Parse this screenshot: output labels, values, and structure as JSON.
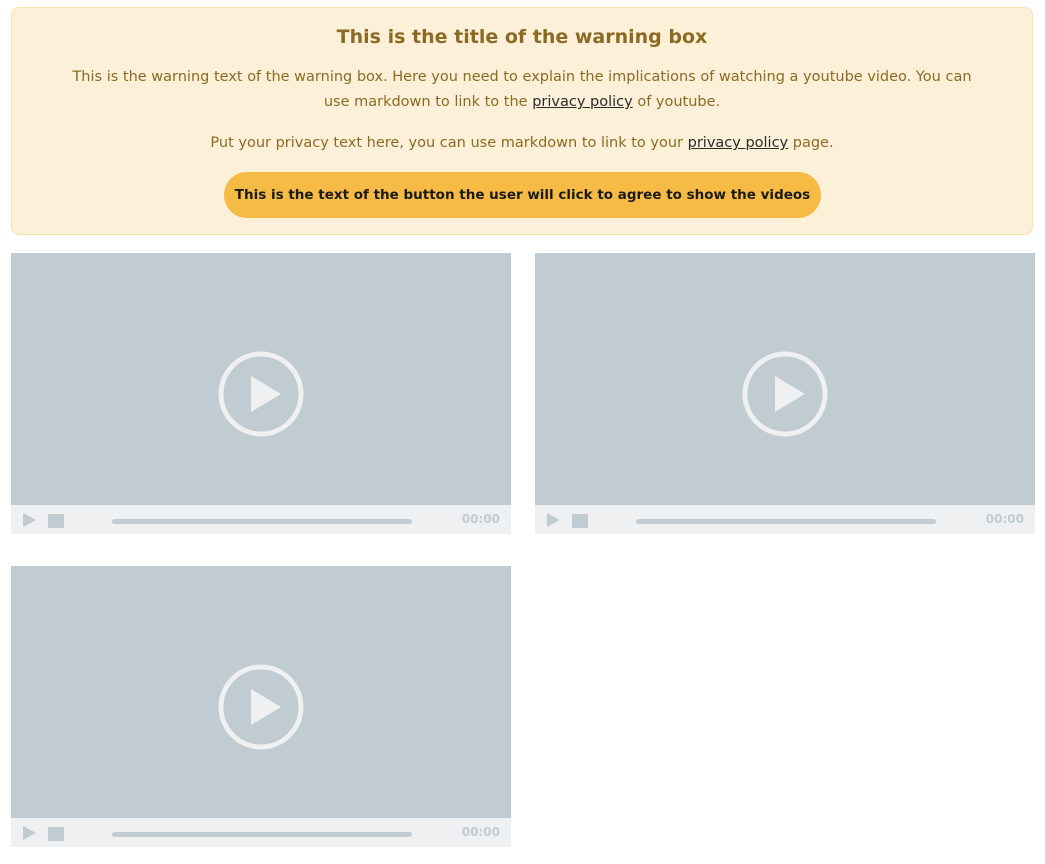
{
  "warning": {
    "title": "This is the title of the warning box",
    "text_before_link": "This is the warning text of the warning box. Here you need to explain the implications of watching a youtube video. You can use markdown to link to the ",
    "text_link": "privacy policy",
    "text_after_link": " of youtube.",
    "privacy_before_link": "Put your privacy text here, you can use markdown to link to your ",
    "privacy_link": "privacy policy",
    "privacy_after_link": " page.",
    "button_label": "This is the text of the button the user will click to agree to show the videos"
  },
  "videos": [
    {
      "time": "00:00"
    },
    {
      "time": "00:00"
    },
    {
      "time": "00:00"
    }
  ],
  "colors": {
    "warning_bg": "#fdf0d8",
    "warning_text": "#8b6a24",
    "button_bg": "#f5bb44",
    "placeholder_bg": "#c1cbd2",
    "controls_bg": "#eef0f2"
  },
  "icons": {
    "big_play": "play-circle-icon",
    "small_play": "play-icon",
    "stop": "stop-icon"
  }
}
